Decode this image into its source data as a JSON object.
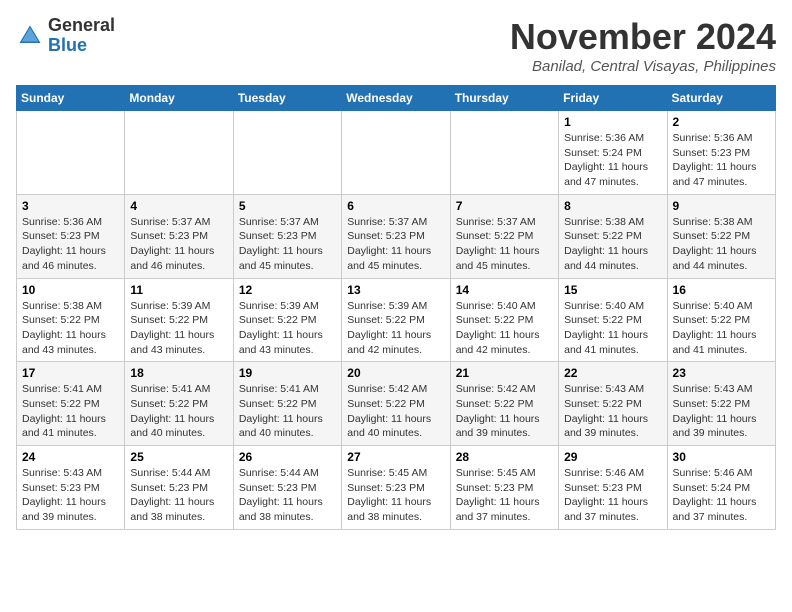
{
  "header": {
    "logo": {
      "general": "General",
      "blue": "Blue"
    },
    "title": "November 2024",
    "location": "Banilad, Central Visayas, Philippines"
  },
  "weekdays": [
    "Sunday",
    "Monday",
    "Tuesday",
    "Wednesday",
    "Thursday",
    "Friday",
    "Saturday"
  ],
  "weeks": [
    [
      {
        "day": "",
        "info": ""
      },
      {
        "day": "",
        "info": ""
      },
      {
        "day": "",
        "info": ""
      },
      {
        "day": "",
        "info": ""
      },
      {
        "day": "",
        "info": ""
      },
      {
        "day": "1",
        "info": "Sunrise: 5:36 AM\nSunset: 5:24 PM\nDaylight: 11 hours and 47 minutes."
      },
      {
        "day": "2",
        "info": "Sunrise: 5:36 AM\nSunset: 5:23 PM\nDaylight: 11 hours and 47 minutes."
      }
    ],
    [
      {
        "day": "3",
        "info": "Sunrise: 5:36 AM\nSunset: 5:23 PM\nDaylight: 11 hours and 46 minutes."
      },
      {
        "day": "4",
        "info": "Sunrise: 5:37 AM\nSunset: 5:23 PM\nDaylight: 11 hours and 46 minutes."
      },
      {
        "day": "5",
        "info": "Sunrise: 5:37 AM\nSunset: 5:23 PM\nDaylight: 11 hours and 45 minutes."
      },
      {
        "day": "6",
        "info": "Sunrise: 5:37 AM\nSunset: 5:23 PM\nDaylight: 11 hours and 45 minutes."
      },
      {
        "day": "7",
        "info": "Sunrise: 5:37 AM\nSunset: 5:22 PM\nDaylight: 11 hours and 45 minutes."
      },
      {
        "day": "8",
        "info": "Sunrise: 5:38 AM\nSunset: 5:22 PM\nDaylight: 11 hours and 44 minutes."
      },
      {
        "day": "9",
        "info": "Sunrise: 5:38 AM\nSunset: 5:22 PM\nDaylight: 11 hours and 44 minutes."
      }
    ],
    [
      {
        "day": "10",
        "info": "Sunrise: 5:38 AM\nSunset: 5:22 PM\nDaylight: 11 hours and 43 minutes."
      },
      {
        "day": "11",
        "info": "Sunrise: 5:39 AM\nSunset: 5:22 PM\nDaylight: 11 hours and 43 minutes."
      },
      {
        "day": "12",
        "info": "Sunrise: 5:39 AM\nSunset: 5:22 PM\nDaylight: 11 hours and 43 minutes."
      },
      {
        "day": "13",
        "info": "Sunrise: 5:39 AM\nSunset: 5:22 PM\nDaylight: 11 hours and 42 minutes."
      },
      {
        "day": "14",
        "info": "Sunrise: 5:40 AM\nSunset: 5:22 PM\nDaylight: 11 hours and 42 minutes."
      },
      {
        "day": "15",
        "info": "Sunrise: 5:40 AM\nSunset: 5:22 PM\nDaylight: 11 hours and 41 minutes."
      },
      {
        "day": "16",
        "info": "Sunrise: 5:40 AM\nSunset: 5:22 PM\nDaylight: 11 hours and 41 minutes."
      }
    ],
    [
      {
        "day": "17",
        "info": "Sunrise: 5:41 AM\nSunset: 5:22 PM\nDaylight: 11 hours and 41 minutes."
      },
      {
        "day": "18",
        "info": "Sunrise: 5:41 AM\nSunset: 5:22 PM\nDaylight: 11 hours and 40 minutes."
      },
      {
        "day": "19",
        "info": "Sunrise: 5:41 AM\nSunset: 5:22 PM\nDaylight: 11 hours and 40 minutes."
      },
      {
        "day": "20",
        "info": "Sunrise: 5:42 AM\nSunset: 5:22 PM\nDaylight: 11 hours and 40 minutes."
      },
      {
        "day": "21",
        "info": "Sunrise: 5:42 AM\nSunset: 5:22 PM\nDaylight: 11 hours and 39 minutes."
      },
      {
        "day": "22",
        "info": "Sunrise: 5:43 AM\nSunset: 5:22 PM\nDaylight: 11 hours and 39 minutes."
      },
      {
        "day": "23",
        "info": "Sunrise: 5:43 AM\nSunset: 5:22 PM\nDaylight: 11 hours and 39 minutes."
      }
    ],
    [
      {
        "day": "24",
        "info": "Sunrise: 5:43 AM\nSunset: 5:23 PM\nDaylight: 11 hours and 39 minutes."
      },
      {
        "day": "25",
        "info": "Sunrise: 5:44 AM\nSunset: 5:23 PM\nDaylight: 11 hours and 38 minutes."
      },
      {
        "day": "26",
        "info": "Sunrise: 5:44 AM\nSunset: 5:23 PM\nDaylight: 11 hours and 38 minutes."
      },
      {
        "day": "27",
        "info": "Sunrise: 5:45 AM\nSunset: 5:23 PM\nDaylight: 11 hours and 38 minutes."
      },
      {
        "day": "28",
        "info": "Sunrise: 5:45 AM\nSunset: 5:23 PM\nDaylight: 11 hours and 37 minutes."
      },
      {
        "day": "29",
        "info": "Sunrise: 5:46 AM\nSunset: 5:23 PM\nDaylight: 11 hours and 37 minutes."
      },
      {
        "day": "30",
        "info": "Sunrise: 5:46 AM\nSunset: 5:24 PM\nDaylight: 11 hours and 37 minutes."
      }
    ]
  ]
}
